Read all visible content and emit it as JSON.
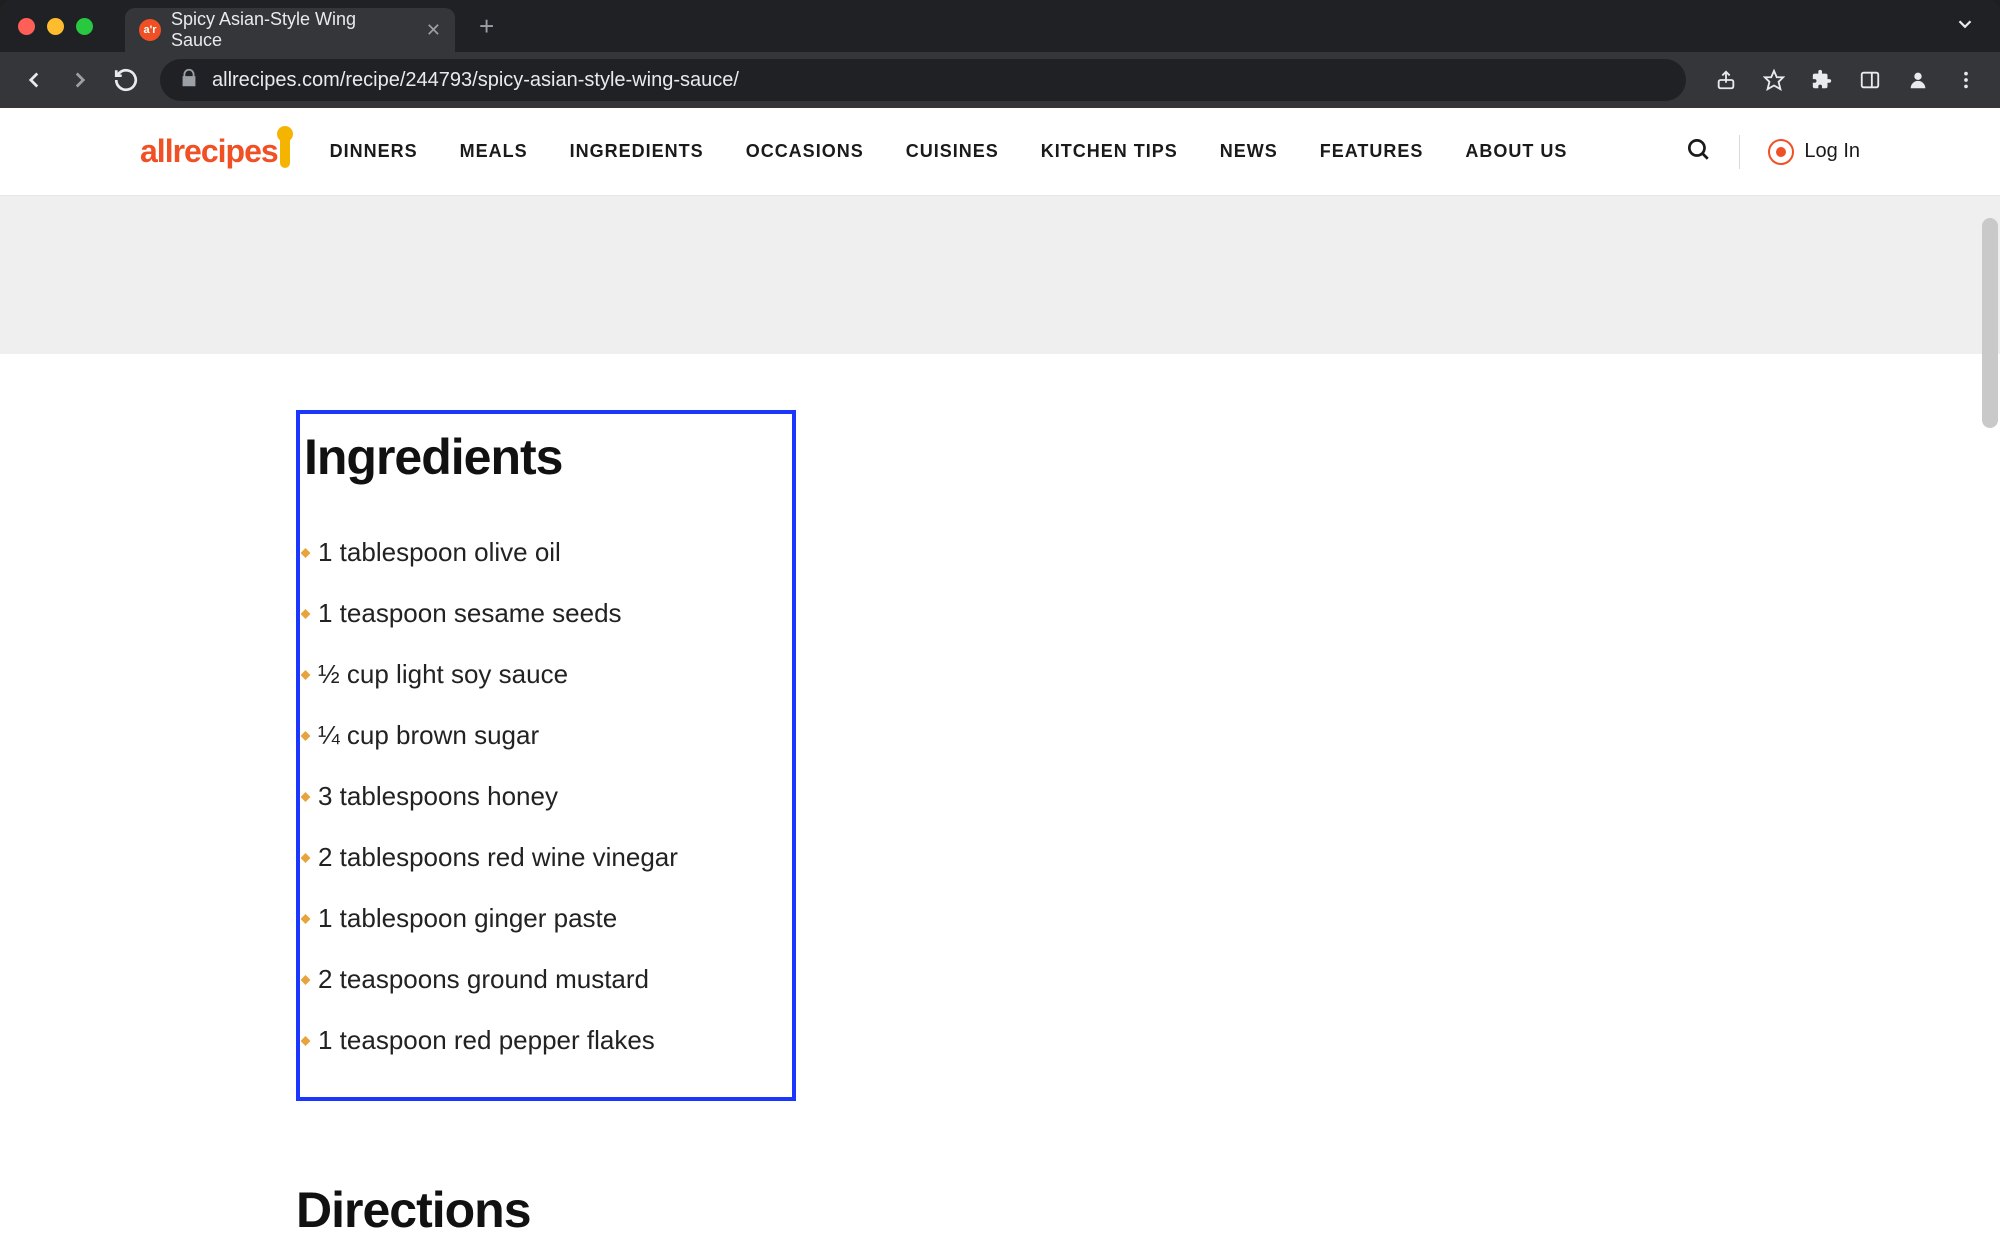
{
  "browser": {
    "tab_title": "Spicy Asian-Style Wing Sauce",
    "url": "allrecipes.com/recipe/244793/spicy-asian-style-wing-sauce/"
  },
  "header": {
    "logo_text": "allrecipes",
    "nav": [
      "DINNERS",
      "MEALS",
      "INGREDIENTS",
      "OCCASIONS",
      "CUISINES",
      "KITCHEN TIPS",
      "NEWS",
      "FEATURES",
      "ABOUT US"
    ],
    "login_label": "Log In"
  },
  "recipe": {
    "ingredients_heading": "Ingredients",
    "ingredients": [
      "1 tablespoon olive oil",
      "1 teaspoon sesame seeds",
      "½ cup light soy sauce",
      "¼ cup brown sugar",
      "3 tablespoons honey",
      "2 tablespoons red wine vinegar",
      "1 tablespoon ginger paste",
      "2 teaspoons ground mustard",
      "1 teaspoon red pepper flakes"
    ],
    "directions_heading": "Directions"
  }
}
